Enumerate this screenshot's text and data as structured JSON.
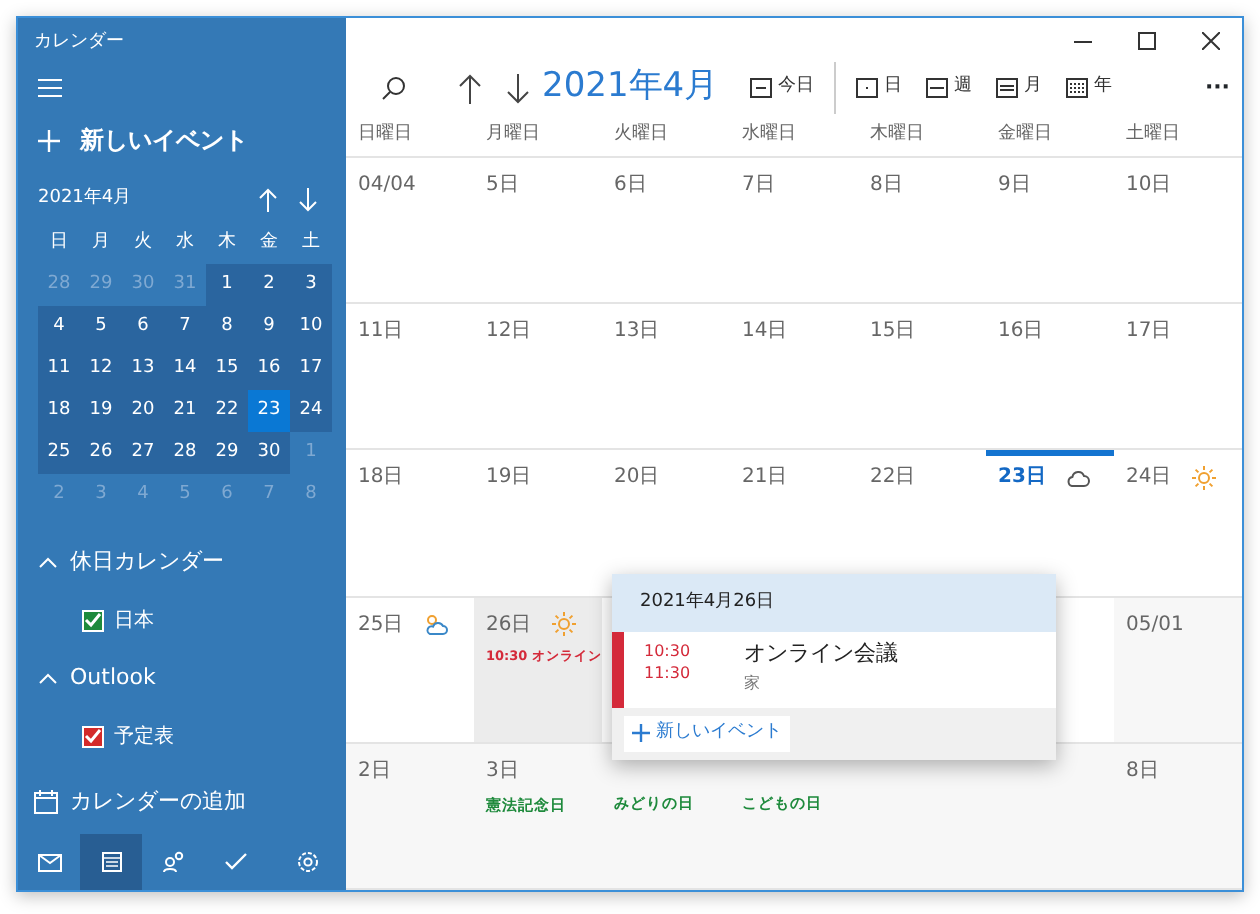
{
  "window": {
    "title": "カレンダー"
  },
  "sidebar": {
    "new_event": "新しいイベント",
    "mini_calendar": {
      "title": "2021年4月",
      "weekdays": [
        "日",
        "月",
        "火",
        "水",
        "木",
        "金",
        "土"
      ],
      "days": [
        {
          "label": "28",
          "in_month": false,
          "selected": false
        },
        {
          "label": "29",
          "in_month": false,
          "selected": false
        },
        {
          "label": "30",
          "in_month": false,
          "selected": false
        },
        {
          "label": "31",
          "in_month": false,
          "selected": false
        },
        {
          "label": "1",
          "in_month": true,
          "selected": false
        },
        {
          "label": "2",
          "in_month": true,
          "selected": false
        },
        {
          "label": "3",
          "in_month": true,
          "selected": false
        },
        {
          "label": "4",
          "in_month": true,
          "selected": false
        },
        {
          "label": "5",
          "in_month": true,
          "selected": false
        },
        {
          "label": "6",
          "in_month": true,
          "selected": false
        },
        {
          "label": "7",
          "in_month": true,
          "selected": false
        },
        {
          "label": "8",
          "in_month": true,
          "selected": false
        },
        {
          "label": "9",
          "in_month": true,
          "selected": false
        },
        {
          "label": "10",
          "in_month": true,
          "selected": false
        },
        {
          "label": "11",
          "in_month": true,
          "selected": false
        },
        {
          "label": "12",
          "in_month": true,
          "selected": false
        },
        {
          "label": "13",
          "in_month": true,
          "selected": false
        },
        {
          "label": "14",
          "in_month": true,
          "selected": false
        },
        {
          "label": "15",
          "in_month": true,
          "selected": false
        },
        {
          "label": "16",
          "in_month": true,
          "selected": false
        },
        {
          "label": "17",
          "in_month": true,
          "selected": false
        },
        {
          "label": "18",
          "in_month": true,
          "selected": false
        },
        {
          "label": "19",
          "in_month": true,
          "selected": false
        },
        {
          "label": "20",
          "in_month": true,
          "selected": false
        },
        {
          "label": "21",
          "in_month": true,
          "selected": false
        },
        {
          "label": "22",
          "in_month": true,
          "selected": false
        },
        {
          "label": "23",
          "in_month": true,
          "selected": true
        },
        {
          "label": "24",
          "in_month": true,
          "selected": false
        },
        {
          "label": "25",
          "in_month": true,
          "selected": false
        },
        {
          "label": "26",
          "in_month": true,
          "selected": false
        },
        {
          "label": "27",
          "in_month": true,
          "selected": false
        },
        {
          "label": "28",
          "in_month": true,
          "selected": false
        },
        {
          "label": "29",
          "in_month": true,
          "selected": false
        },
        {
          "label": "30",
          "in_month": true,
          "selected": false
        },
        {
          "label": "1",
          "in_month": false,
          "selected": false
        },
        {
          "label": "2",
          "in_month": false,
          "selected": false
        },
        {
          "label": "3",
          "in_month": false,
          "selected": false
        },
        {
          "label": "4",
          "in_month": false,
          "selected": false
        },
        {
          "label": "5",
          "in_month": false,
          "selected": false
        },
        {
          "label": "6",
          "in_month": false,
          "selected": false
        },
        {
          "label": "7",
          "in_month": false,
          "selected": false
        },
        {
          "label": "8",
          "in_month": false,
          "selected": false
        }
      ]
    },
    "groups": [
      {
        "title": "休日カレンダー",
        "expanded": true,
        "items": [
          {
            "label": "日本",
            "checked": true,
            "color": "#1e8a3c"
          }
        ]
      },
      {
        "title": "Outlook",
        "expanded": true,
        "items": [
          {
            "label": "予定表",
            "checked": true,
            "color": "#d42a2a"
          }
        ]
      }
    ],
    "add_calendar": "カレンダーの追加",
    "nav": [
      {
        "kind": "mail",
        "selected": false
      },
      {
        "kind": "calendar",
        "selected": true
      },
      {
        "kind": "people",
        "selected": false
      },
      {
        "kind": "todo",
        "selected": false
      },
      {
        "kind": "settings",
        "selected": false
      }
    ]
  },
  "toolbar": {
    "month_title": "2021年4月",
    "today": "今日",
    "views": [
      {
        "kind": "day",
        "label": "日"
      },
      {
        "kind": "week",
        "label": "週"
      },
      {
        "kind": "month",
        "label": "月"
      },
      {
        "kind": "year",
        "label": "年"
      }
    ],
    "more": "···"
  },
  "weekdays": [
    "日曜日",
    "月曜日",
    "火曜日",
    "水曜日",
    "木曜日",
    "金曜日",
    "土曜日"
  ],
  "weeks": [
    [
      {
        "label": "04/04"
      },
      {
        "label": "5日"
      },
      {
        "label": "6日"
      },
      {
        "label": "7日"
      },
      {
        "label": "8日"
      },
      {
        "label": "9日"
      },
      {
        "label": "10日"
      }
    ],
    [
      {
        "label": "11日"
      },
      {
        "label": "12日"
      },
      {
        "label": "13日"
      },
      {
        "label": "14日"
      },
      {
        "label": "15日"
      },
      {
        "label": "16日"
      },
      {
        "label": "17日"
      }
    ],
    [
      {
        "label": "18日"
      },
      {
        "label": "19日"
      },
      {
        "label": "20日"
      },
      {
        "label": "21日"
      },
      {
        "label": "22日"
      },
      {
        "label": "23日",
        "today": true,
        "weather": {
          "kind": "cloud"
        }
      },
      {
        "label": "24日",
        "weather": {
          "kind": "sun"
        }
      }
    ],
    [
      {
        "label": "25日",
        "weather": {
          "kind": "partly-cloudy"
        }
      },
      {
        "label": "26日",
        "selected": true,
        "weather": {
          "kind": "sun"
        },
        "events": [
          "10:30 オンライン"
        ]
      },
      {
        "label": "05/01",
        "other_month": true
      }
    ],
    [
      {
        "label": "2日",
        "other_month": true
      },
      {
        "label": "3日",
        "other_month": true,
        "holidays": [
          "憲法記念日"
        ]
      },
      {
        "other_month": true,
        "holidays": [
          "みどりの日"
        ]
      },
      {
        "other_month": true,
        "holidays": [
          "こどもの日"
        ]
      },
      {
        "other_month": true
      },
      {
        "other_month": true
      },
      {
        "label": "8日",
        "other_month": true
      }
    ]
  ],
  "popup": {
    "date": "2021年4月26日",
    "event": {
      "start": "10:30",
      "end": "11:30",
      "title": "オンライン会議",
      "location": "家",
      "color": "#d42a3a"
    },
    "new_event": "新しいイベント"
  }
}
